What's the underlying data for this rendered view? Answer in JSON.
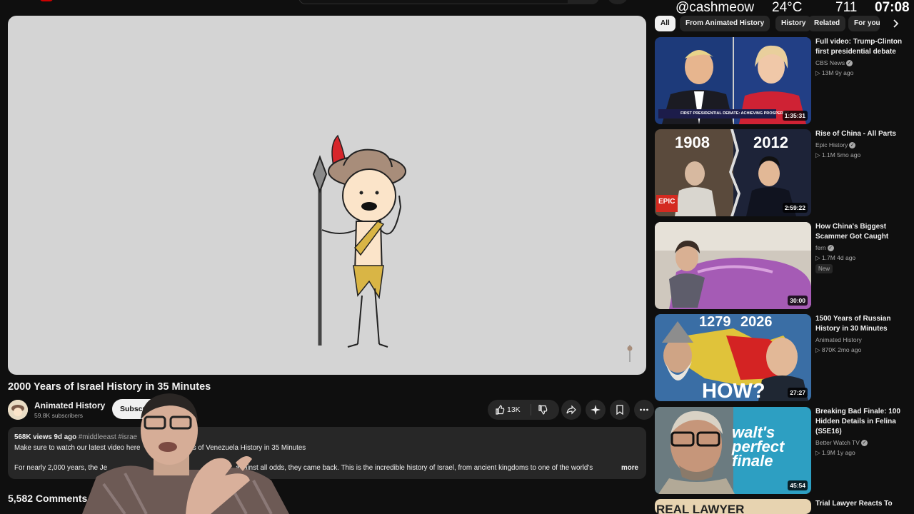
{
  "overlay": {
    "handle": "@cashmeow",
    "temperature": "24°C",
    "number": "711",
    "time": "07:08"
  },
  "video": {
    "title": "2000 Years of Israel History in 35 Minutes",
    "channel": "Animated History",
    "subscribers": "59.8K subscribers",
    "subscribe_label": "Subscri",
    "likes": "13K"
  },
  "description": {
    "views_date": "568K views  9d ago",
    "tags": "#middleeast #israe",
    "line1_a": "Make sure to watch our latest video here",
    "line1_b": "rs of Venezuela",
    "line1_c": "History in 35 Minutes",
    "line2_a": "For nearly 2,000 years, the Je",
    "line2_b": "against all odds, they came back. This is the incredible history of Israel, from ancient kingdoms to one of the world's",
    "more": "more"
  },
  "comments": {
    "count_label": "5,582 Comments"
  },
  "chips": [
    "All",
    "From Animated History",
    "History",
    "Related",
    "For you"
  ],
  "recommendations": [
    {
      "title": "Full video: Trump-Clinton first presidential debate",
      "channel": "CBS News",
      "verified": true,
      "meta": "▷ 13M  9y ago",
      "duration": "1:35:31",
      "thumb_text": "FIRST PRESIDENTIAL DEBATE: ACHIEVING PROSPERITY"
    },
    {
      "title": "Rise of China - All Parts",
      "channel": "Epic History",
      "verified": true,
      "meta": "▷ 1.1M  5mo ago",
      "duration": "2:59:22",
      "thumb_left": "1908",
      "thumb_right": "2012",
      "thumb_tag": "EPIC"
    },
    {
      "title": "How China's Biggest Scammer Got Caught",
      "channel": "fern",
      "verified": true,
      "meta": "▷ 1.7M  4d ago",
      "badge": "New",
      "duration": "30:00"
    },
    {
      "title": "1500 Years of Russian History in 30 Minutes",
      "channel": "Animated History",
      "verified": false,
      "meta": "▷ 870K  2mo ago",
      "duration": "27:27",
      "thumb_left": "1279",
      "thumb_right": "2026",
      "thumb_big": "HOW?"
    },
    {
      "title": "Breaking Bad Finale: 100 Hidden Details in Felina (S5E16)",
      "channel": "Better Watch TV",
      "verified": true,
      "meta": "▷ 1.9M  1y ago",
      "duration": "45:54",
      "thumb_big": "walt's perfect finale"
    },
    {
      "title": "Trial Lawyer Reacts To",
      "thumb_text": "REAL LAWYER"
    }
  ],
  "colors": {
    "background": "#0f0f0f",
    "surface": "#272727",
    "player_bg": "#d4d4d4"
  }
}
